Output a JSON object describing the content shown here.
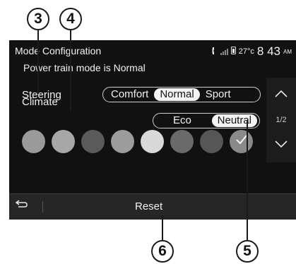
{
  "callouts": [
    "3",
    "4",
    "5",
    "6"
  ],
  "header": {
    "title": "Mode Configuration",
    "subtitle": "Power train mode is Normal",
    "temperature": "27°c",
    "time": "8 43",
    "ampm": "AM"
  },
  "steering": {
    "label": "Steering",
    "options": [
      "Comfort",
      "Normal",
      "Sport"
    ],
    "selected": "Normal"
  },
  "climate": {
    "label": "Climate",
    "options": [
      "Eco",
      "Neutral"
    ],
    "selected": "Neutral"
  },
  "page_indicator": "1/2",
  "ambient_colors": {
    "swatches": [
      "#9a9a9a",
      "#a7a7a7",
      "#5a5a5a",
      "#9c9c9c",
      "#d9d9d9",
      "#6a6a6a",
      "#565656",
      "#8a8a8a"
    ],
    "selected_index": 7
  },
  "bottom_bar": {
    "reset_label": "Reset"
  },
  "icons": [
    "phone-icon",
    "signal-icon",
    "sim-icon",
    "up-arrow-icon",
    "down-arrow-icon",
    "check-icon",
    "back-icon"
  ]
}
